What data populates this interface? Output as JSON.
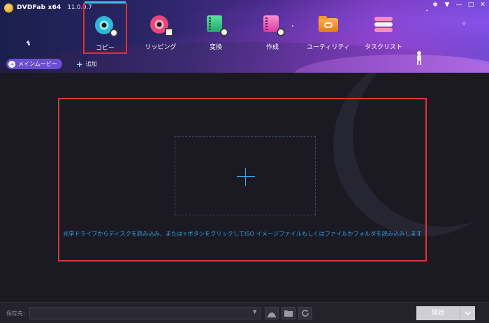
{
  "app": {
    "name": "DVDFab x64",
    "version": "11.0.0.7"
  },
  "window_controls": [
    {
      "name": "skin-icon",
      "glyph": "♚"
    },
    {
      "name": "menu-icon",
      "glyph": "▼"
    },
    {
      "name": "minimize-icon",
      "glyph": "—"
    },
    {
      "name": "maximize-icon",
      "glyph": "□"
    },
    {
      "name": "close-icon",
      "glyph": "✕"
    }
  ],
  "nav": {
    "tabs": [
      {
        "id": "copy",
        "label": "コピー",
        "icon": "copy-disc-icon",
        "active": true
      },
      {
        "id": "ripper",
        "label": "リッピング",
        "icon": "ripper-disc-icon",
        "active": false
      },
      {
        "id": "converter",
        "label": "変換",
        "icon": "converter-film-icon",
        "active": false
      },
      {
        "id": "creator",
        "label": "作成",
        "icon": "creator-film-icon",
        "active": false
      },
      {
        "id": "utility",
        "label": "ユーティリティ",
        "icon": "utility-folder-icon",
        "active": false
      },
      {
        "id": "tasks",
        "label": "タスクリスト",
        "icon": "task-list-icon",
        "active": false
      }
    ]
  },
  "subbar": {
    "main_movie_label": "メインムービー",
    "add_label": "追加"
  },
  "drop_area": {
    "hint": "光学ドライブからディスクを読み込み、または+ボタンをクリックしてISO イメージファイルもしくはファイルかフォルダを読み込みします"
  },
  "footer": {
    "save_label": "保存先:",
    "save_value": "",
    "start_label": "開始"
  },
  "colors": {
    "accent_blue": "#2f9fe6",
    "highlight_red": "#d63a2f",
    "pill_purple": "#6b4ed0"
  }
}
